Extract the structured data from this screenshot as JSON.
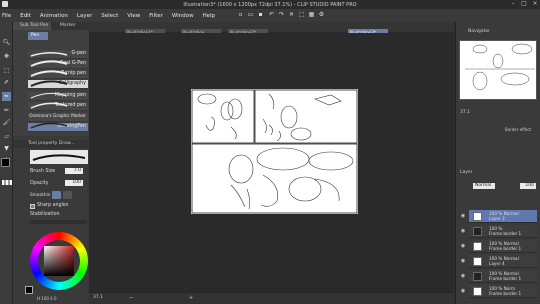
{
  "window": {
    "title": "Illustration3* (1600 x 1200px 72dpi 37.1%)  - CLIP STUDIO PAINT PRO"
  },
  "menu": [
    "File",
    "Edit",
    "Animation",
    "Layer",
    "Select",
    "View",
    "Filter",
    "Window",
    "Help"
  ],
  "subtool": {
    "tabs": [
      "Sub Tool Pen",
      "Marker"
    ],
    "group": "Pen",
    "brushes": [
      "G-pen",
      "Real G-Pen",
      "Turnip pen",
      "Calligraphy",
      "Mapping pen",
      "Textured pen",
      "Osmiana's Graphic Marker",
      "DrawingPen"
    ]
  },
  "toolprop": {
    "title": "Tool property Draw...",
    "brush_size_label": "Brush Size",
    "brush_size": "7.0",
    "opacity_label": "Opacity",
    "opacity": "100",
    "smoothing_label": "Smoothin",
    "sharp_angles": "Sharp angles",
    "stabilization_label": "Stabilization"
  },
  "tabs": [
    "Illustration1*",
    "Illustration",
    "Illustration2*",
    "Illustration3*"
  ],
  "status": {
    "zoom": "37.1"
  },
  "navigator": {
    "title": "Navigator",
    "zoom": "37.1"
  },
  "layer_props": {
    "label": "Layer Property",
    "border": "Border effect"
  },
  "layers": {
    "blend": "Normal",
    "opacity": "100",
    "items": [
      {
        "pct": "100 % Normal",
        "name": "Layer 3"
      },
      {
        "pct": "100 %",
        "name": "Frame border 1"
      },
      {
        "pct": "100 % Normal",
        "name": "Frame border 1"
      },
      {
        "pct": "100 % Normal",
        "name": "Layer 4"
      },
      {
        "pct": "100 % Normal",
        "name": "Frame border 1"
      },
      {
        "pct": "100 % Norm",
        "name": "Frame border 1"
      }
    ]
  },
  "colors": {
    "accent": "#6a7ea5",
    "main": "#000000",
    "sub": "#ffffff",
    "picker": "#c61f1f"
  }
}
